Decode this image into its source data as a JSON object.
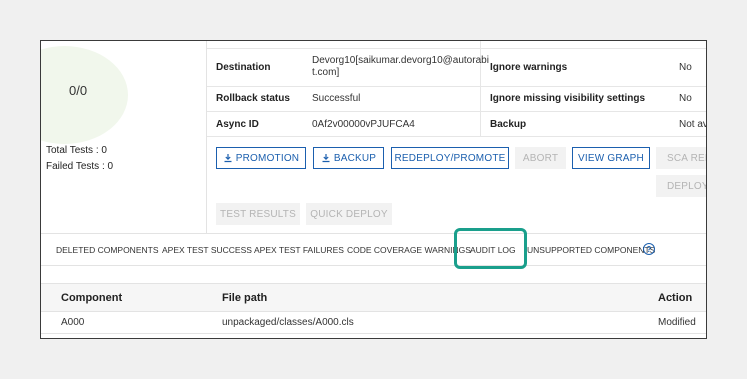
{
  "tests": {
    "ratio": "0/0",
    "total_label": "Total Tests : 0",
    "failed_label": "Failed Tests : 0"
  },
  "details": {
    "destination_label": "Destination",
    "destination_value_line1": "Devorg10[saikumar.devorg10@autorabi",
    "destination_value_line2": "t.com]",
    "ignore_warnings_label": "Ignore warnings",
    "ignore_warnings_value": "No",
    "rollback_label": "Rollback status",
    "rollback_value": "Successful",
    "ignore_missing_label": "Ignore missing visibility settings",
    "ignore_missing_value": "No",
    "async_label": "Async ID",
    "async_value": "0Af2v00000vPJUFCA4",
    "backup_label": "Backup",
    "backup_value": "Not av"
  },
  "actions": {
    "promotion": "PROMOTION",
    "backup": "BACKUP",
    "redeploy": "REDEPLOY/PROMOTE",
    "abort": "ABORT",
    "view_graph": "VIEW GRAPH",
    "sca_report": "SCA REP",
    "deploy": "DEPLOYE",
    "test_results": "TEST RESULTS",
    "quick_deploy": "QUICK DEPLOY"
  },
  "tabs": {
    "deleted_components": "DELETED COMPONENTS",
    "apex_test_success": "APEX TEST SUCCESS",
    "apex_test_failures": "APEX TEST FAILURES",
    "code_coverage_warnings": "CODE COVERAGE WARNINGS",
    "audit_log": "AUDIT LOG",
    "unsupported_components": "UNSUPPORTED COMPONENTS",
    "help": "?"
  },
  "components_table": {
    "headers": [
      "Component",
      "File path",
      "Action"
    ],
    "rows": [
      [
        "A000",
        "unpackaged/classes/A000.cls",
        "Modified"
      ]
    ]
  },
  "colors": {
    "primary": "#1b5fae",
    "highlight": "#1a9f8c",
    "circle_fill": "#f1f7ec"
  },
  "icons": {
    "promotion": "download-icon",
    "backup": "download-icon",
    "help": "help-circle-icon"
  }
}
